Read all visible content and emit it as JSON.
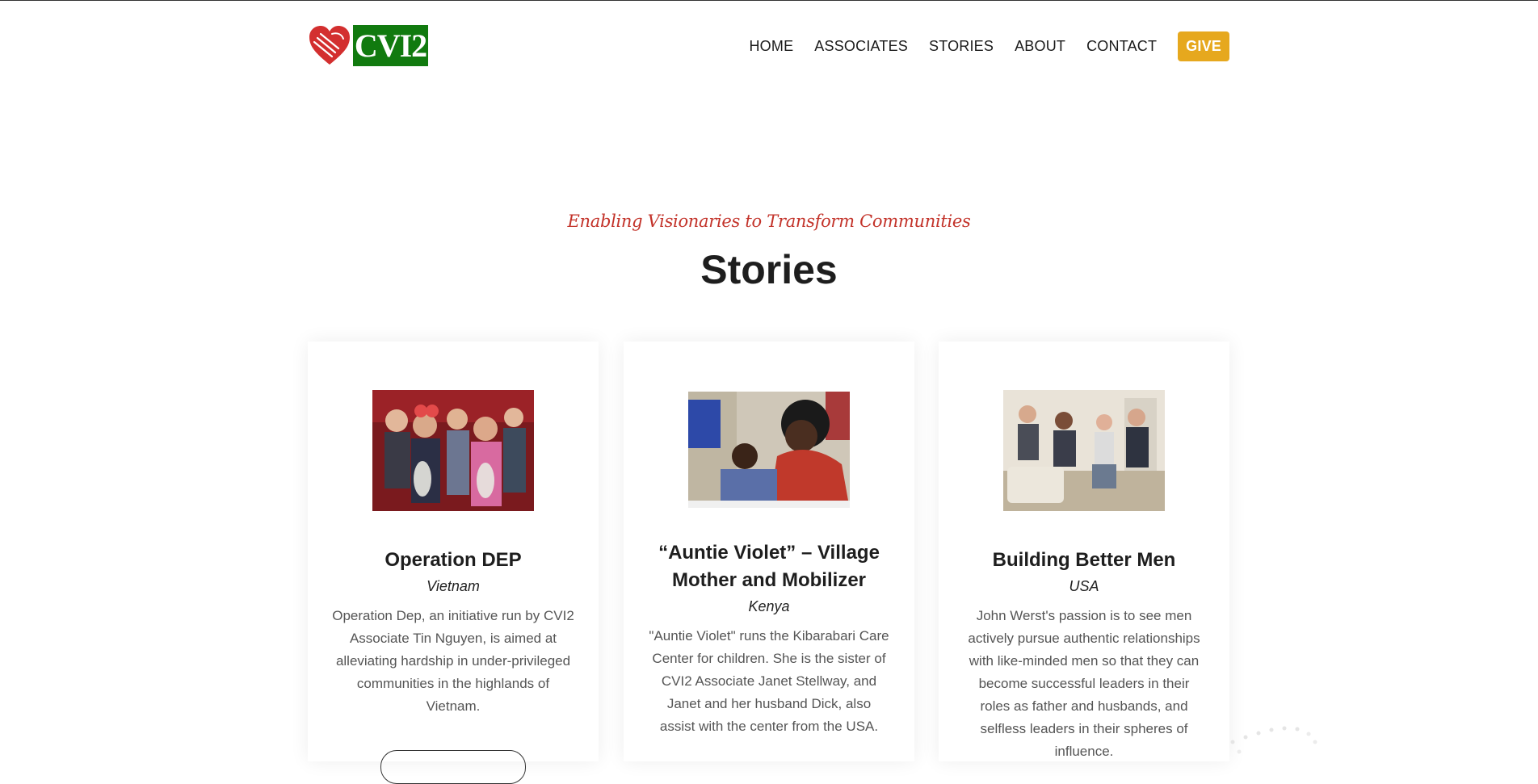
{
  "brand": {
    "name": "CVI2",
    "heart_color": "#d32f2f",
    "box_color": "#117a0f"
  },
  "nav": {
    "items": [
      "HOME",
      "ASSOCIATES",
      "STORIES",
      "ABOUT",
      "CONTACT"
    ],
    "give_label": "GIVE",
    "give_color": "#e6a81e"
  },
  "hero": {
    "tagline": "Enabling Visionaries to Transform Communities",
    "title": "Stories"
  },
  "stories": [
    {
      "title": "Operation DEP",
      "location": "Vietnam",
      "text": "Operation Dep, an initiative run by CVI2 Associate Tin Nguyen, is aimed at alleviating hardship in under-privileged communities in the highlands of Vietnam."
    },
    {
      "title": "“Auntie Violet” – Village Mother and Mobilizer",
      "location": "Kenya",
      "text": "\"Auntie Violet\" runs the Kibarabari Care Center for children. She is the sister of CVI2 Associate Janet Stellway, and Janet and her husband Dick, also assist with the center from the USA."
    },
    {
      "title": "Building Better Men",
      "location": "USA",
      "text": "John Werst's passion is to see men actively pursue authentic relationships with like-minded men so that they can become successful leaders in their roles as father and husbands, and selfless leaders in their spheres of influence."
    }
  ]
}
